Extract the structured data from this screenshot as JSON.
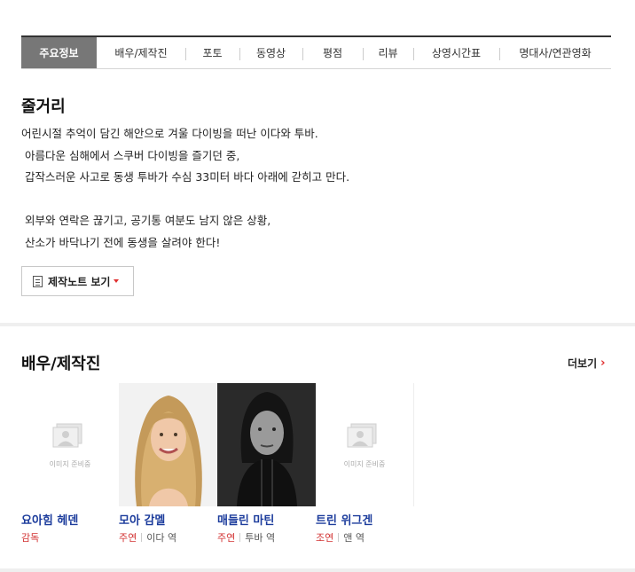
{
  "tabs": [
    {
      "label": "주요정보",
      "active": true
    },
    {
      "label": "배우/제작진"
    },
    {
      "label": "포토"
    },
    {
      "label": "동영상"
    },
    {
      "label": "평점"
    },
    {
      "label": "리뷰"
    },
    {
      "label": "상영시간표"
    },
    {
      "label": "명대사/연관영화"
    }
  ],
  "synopsis": {
    "title": "줄거리",
    "lines": [
      "어린시절 추억이 담긴 해안으로 겨울 다이빙을 떠난 이다와 투바.",
      " 아름다운 심해에서 스쿠버 다이빙을 즐기던 중,",
      " 갑작스러운 사고로 동생 투바가 수심 33미터 바다 아래에 갇히고 만다.",
      " ",
      " 외부와 연락은 끊기고, 공기통 여분도 남지 않은 상황,",
      " 산소가 바닥나기 전에 동생을 살려야 한다!"
    ],
    "note_button": "제작노트 보기"
  },
  "cast": {
    "title": "배우/제작진",
    "more_label": "더보기",
    "placeholder_text": "이미지 준비중",
    "people": [
      {
        "name": "요아힘 헤덴",
        "role": "감독",
        "character": "",
        "photo": "placeholder"
      },
      {
        "name": "모아 감멜",
        "role": "주연",
        "character": "이다 역",
        "photo": "blonde"
      },
      {
        "name": "매들린 마틴",
        "role": "주연",
        "character": "투바 역",
        "photo": "dark"
      },
      {
        "name": "트린 위그겐",
        "role": "조연",
        "character": "앤 역",
        "photo": "placeholder"
      }
    ]
  },
  "colors": {
    "accent": "#d23232",
    "link": "#1c3c9c",
    "tab_active": "#777777"
  }
}
